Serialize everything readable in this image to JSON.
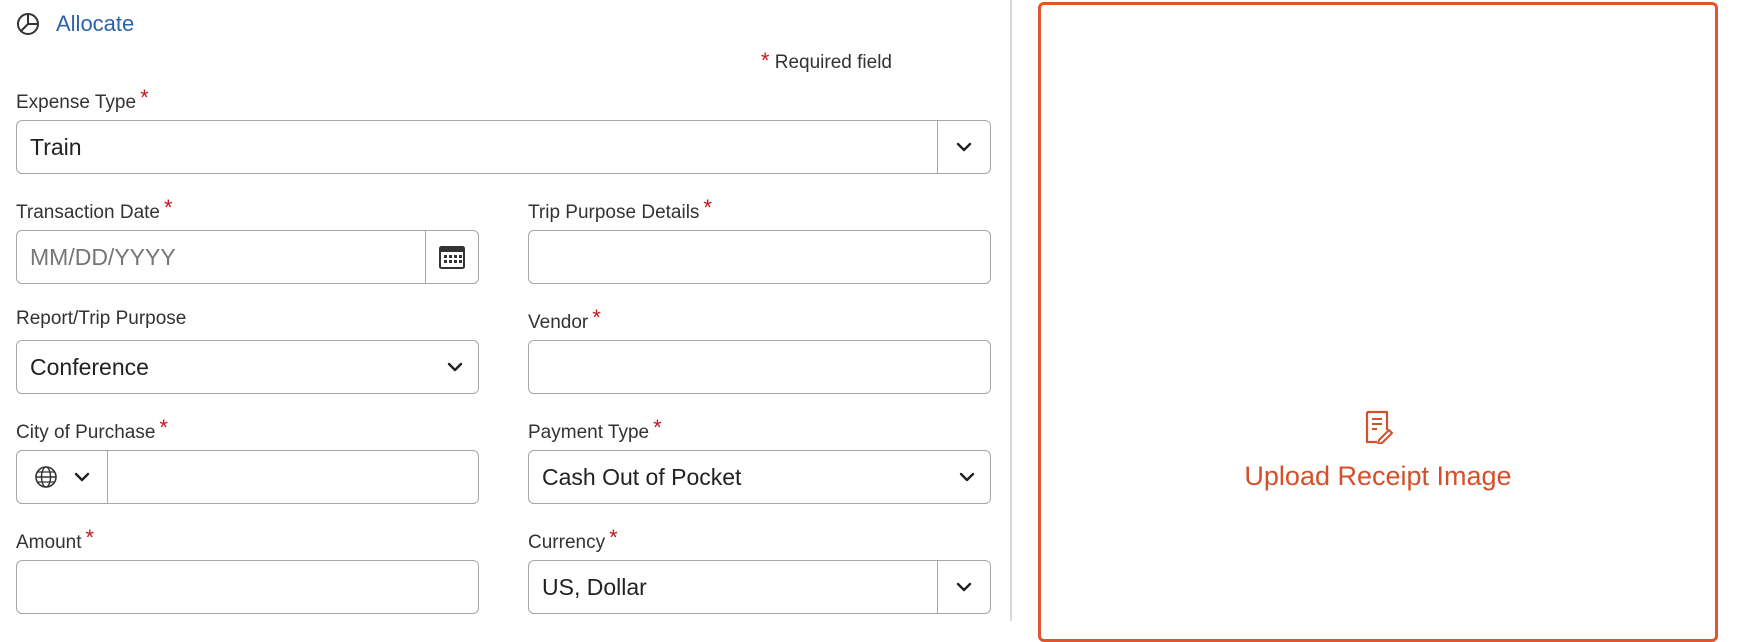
{
  "allocate": {
    "label": "Allocate",
    "icon": "pie-chart-icon"
  },
  "required_note": {
    "star": "*",
    "text": "Required field"
  },
  "required_star": "*",
  "form": {
    "expense_type": {
      "label": "Expense Type",
      "value": "Train"
    },
    "transaction_date": {
      "label": "Transaction Date",
      "placeholder": "MM/DD/YYYY",
      "icon": "calendar-icon"
    },
    "trip_purpose_details": {
      "label": "Trip Purpose Details",
      "value": ""
    },
    "report_trip_purpose": {
      "label": "Report/Trip Purpose",
      "value": "Conference"
    },
    "vendor": {
      "label": "Vendor",
      "value": ""
    },
    "city_of_purchase": {
      "label": "City of Purchase",
      "value": "",
      "icon": "globe-icon"
    },
    "payment_type": {
      "label": "Payment Type",
      "value": "Cash Out of Pocket"
    },
    "amount": {
      "label": "Amount",
      "value": ""
    },
    "currency": {
      "label": "Currency",
      "value": "US, Dollar"
    }
  },
  "upload": {
    "label": "Upload Receipt Image",
    "icon": "receipt-upload-icon"
  },
  "colors": {
    "link": "#2c64a5",
    "required": "#c4161c",
    "upload_accent": "#e0542e",
    "border": "#a7a7a7"
  }
}
